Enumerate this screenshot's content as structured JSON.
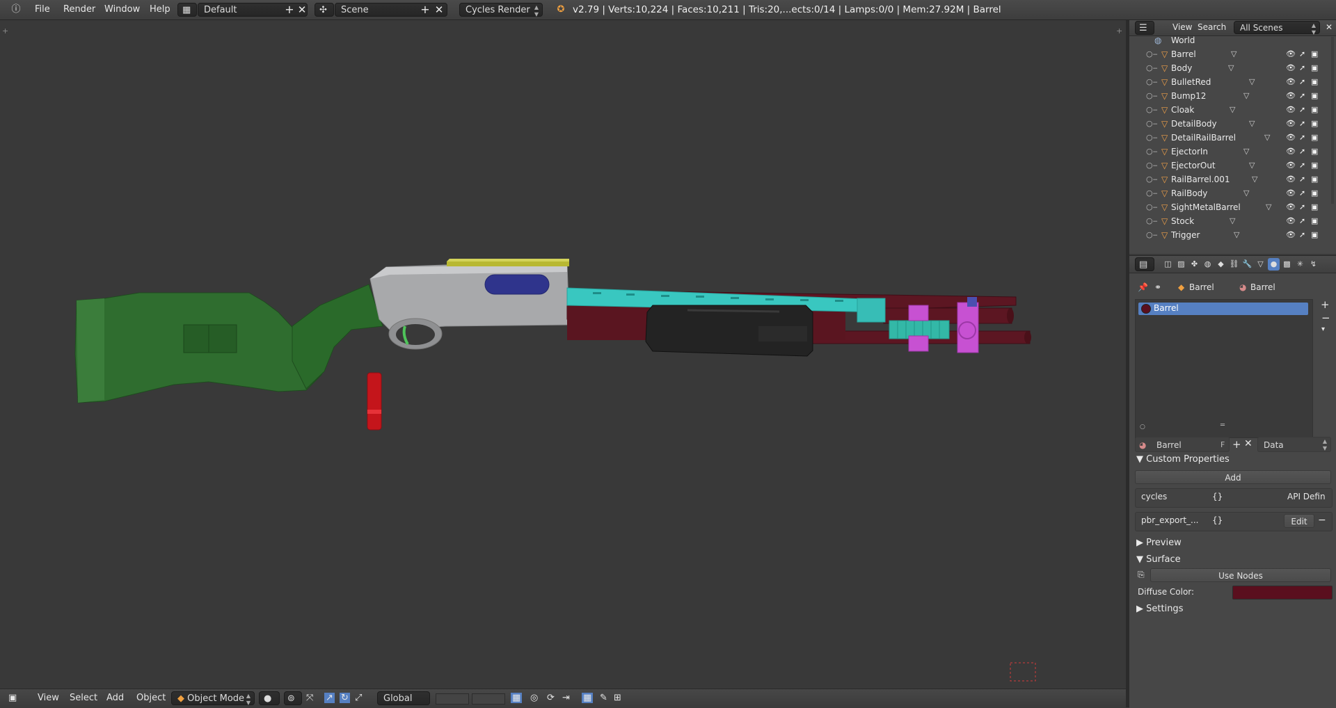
{
  "topbar": {
    "menus": [
      "File",
      "Render",
      "Window",
      "Help"
    ],
    "screen_layout": "Default",
    "scene": "Scene",
    "render_engine": "Cycles Render",
    "stats": "v2.79 | Verts:10,224 | Faces:10,211 | Tris:20,...ects:0/14 | Lamps:0/0 | Mem:27.92M | Barrel"
  },
  "viewport": {
    "objects": [
      {
        "name": "Stock",
        "color": "#2e6b2e"
      },
      {
        "name": "Body",
        "color": "#a7a8aa"
      },
      {
        "name": "Barrel",
        "color": "#5c1622"
      },
      {
        "name": "RailBarrel",
        "color": "#39c7c0"
      },
      {
        "name": "SightMetalBarrel",
        "color": "#b8b832"
      },
      {
        "name": "Cloak",
        "color": "#222222"
      },
      {
        "name": "Bump12",
        "color": "#c751d2"
      },
      {
        "name": "BulletRed",
        "color": "#c4151b"
      },
      {
        "name": "DetailBody",
        "color": "#2f348c"
      },
      {
        "name": "Trigger",
        "color": "#4fc35a"
      }
    ]
  },
  "bottombar": {
    "menus": [
      "View",
      "Select",
      "Add",
      "Object"
    ],
    "mode": "Object Mode",
    "orientation": "Global"
  },
  "outliner": {
    "header": {
      "view": "View",
      "search": "Search",
      "filter": "All Scenes"
    },
    "world": "World",
    "items": [
      "Barrel",
      "Body",
      "BulletRed",
      "Bump12",
      "Cloak",
      "DetailBody",
      "DetailRailBarrel",
      "EjectorIn",
      "EjectorOut",
      "RailBarrel.001",
      "RailBody",
      "SightMetalBarrel",
      "Stock",
      "Trigger"
    ]
  },
  "properties": {
    "breadcrumb": [
      "Barrel",
      "Barrel"
    ],
    "material_slots": [
      "Barrel"
    ],
    "material_name": "Barrel",
    "fake_user": "F",
    "link": "Data",
    "custom_properties": {
      "title": "Custom Properties",
      "add": "Add",
      "props": [
        {
          "name": "cycles",
          "value": "{}",
          "action": "API Defin"
        },
        {
          "name": "pbr_export_...",
          "value": "{}",
          "action": "Edit"
        }
      ]
    },
    "preview": "Preview",
    "surface": {
      "title": "Surface",
      "use_nodes": "Use Nodes",
      "diffuse_label": "Diffuse Color:",
      "diffuse_color": "#5a0f1e"
    },
    "settings": "Settings"
  }
}
